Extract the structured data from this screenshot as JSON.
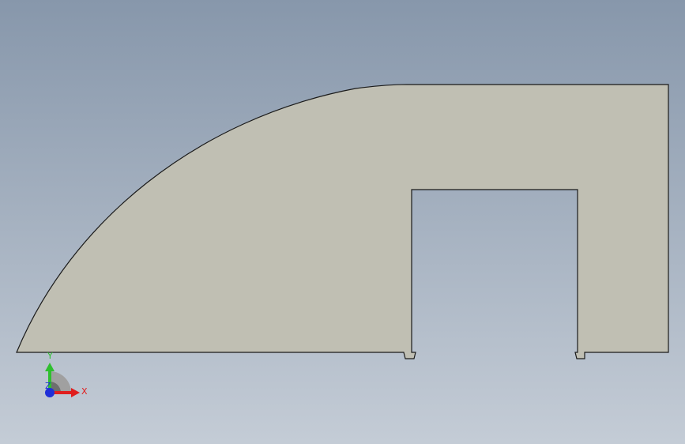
{
  "viewport": {
    "background_top": "#8797ab",
    "background_bottom": "#c4ccd6"
  },
  "part": {
    "fill_color": "#c0bfb3",
    "edge_color": "#1a1a1a"
  },
  "triad": {
    "x_axis": {
      "label": "X",
      "color": "#e01e1e"
    },
    "y_axis": {
      "label": "Y",
      "color": "#2fbf2f"
    },
    "z_axis": {
      "label": "Z",
      "color": "#1f2fd8"
    }
  }
}
